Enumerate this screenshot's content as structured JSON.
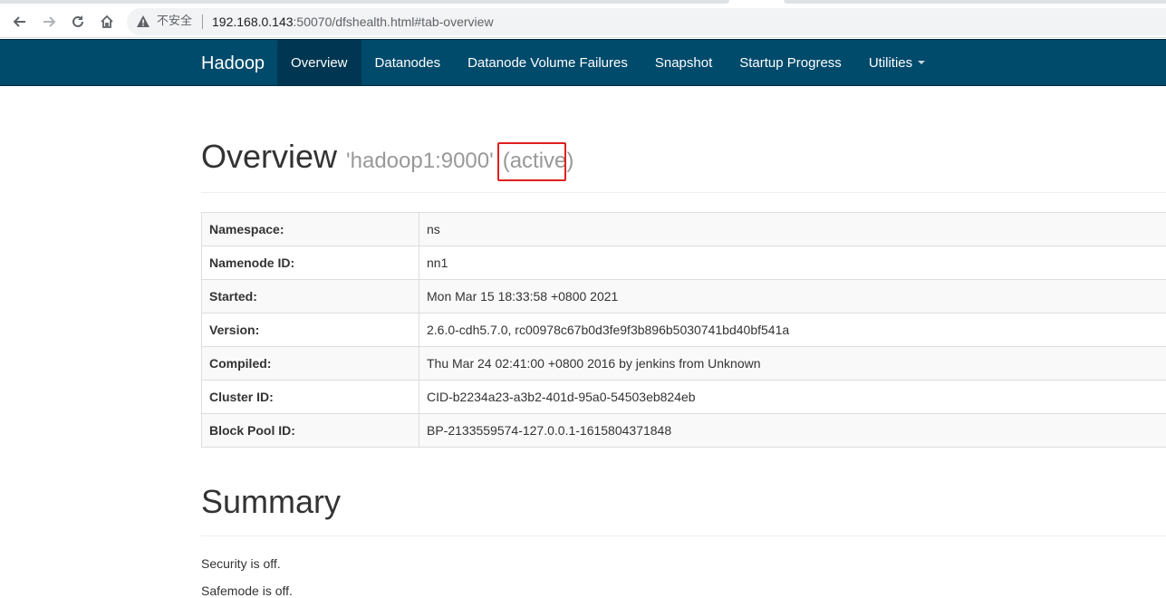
{
  "browser": {
    "security_text": "不安全",
    "url_host": "192.168.0.143",
    "url_rest": ":50070/dfshealth.html#tab-overview",
    "icons": [
      "back-arrow-icon",
      "forward-arrow-icon",
      "reload-icon",
      "home-icon",
      "warning-icon"
    ]
  },
  "navbar": {
    "brand": "Hadoop",
    "items": [
      {
        "label": "Overview",
        "active": true
      },
      {
        "label": "Datanodes",
        "active": false
      },
      {
        "label": "Datanode Volume Failures",
        "active": false
      },
      {
        "label": "Snapshot",
        "active": false
      },
      {
        "label": "Startup Progress",
        "active": false
      },
      {
        "label": "Utilities",
        "active": false,
        "dropdown": true
      }
    ],
    "colors": {
      "background": "#004a6b",
      "active": "#003651"
    }
  },
  "overview": {
    "title": "Overview",
    "host": "'hadoop1:9000'",
    "state": "(active)",
    "highlight_color": "#e02020",
    "rows": [
      {
        "label": "Namespace:",
        "value": "ns"
      },
      {
        "label": "Namenode ID:",
        "value": "nn1"
      },
      {
        "label": "Started:",
        "value": "Mon Mar 15 18:33:58 +0800 2021"
      },
      {
        "label": "Version:",
        "value": "2.6.0-cdh5.7.0, rc00978c67b0d3fe9f3b896b5030741bd40bf541a"
      },
      {
        "label": "Compiled:",
        "value": "Thu Mar 24 02:41:00 +0800 2016 by jenkins from Unknown"
      },
      {
        "label": "Cluster ID:",
        "value": "CID-b2234a23-a3b2-401d-95a0-54503eb824eb"
      },
      {
        "label": "Block Pool ID:",
        "value": "BP-2133559574-127.0.0.1-1615804371848"
      }
    ]
  },
  "summary": {
    "title": "Summary",
    "lines": [
      "Security is off.",
      "Safemode is off."
    ]
  }
}
